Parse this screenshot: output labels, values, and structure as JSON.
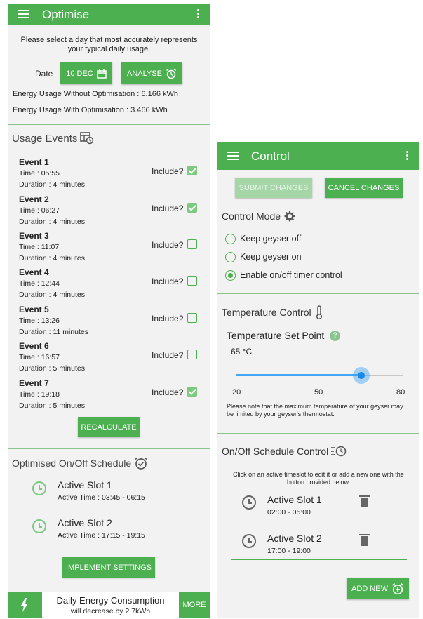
{
  "left": {
    "title": "Optimise",
    "intro": "Please select a day that most accurately represents your typical daily usage.",
    "date_label": "Date",
    "date_button": "10 DEC",
    "analyse_button": "ANALYSE",
    "usage_without": "Energy Usage Without Optimisation : 6.166 kWh",
    "usage_with": "Energy Usage With Optimisation : 3.466 kWh",
    "usage_events_heading": "Usage Events",
    "include_label": "Include?",
    "events": [
      {
        "name": "Event 1",
        "time": "Time : 05:55",
        "duration": "Duration : 4 minutes",
        "included": true
      },
      {
        "name": "Event 2",
        "time": "Time : 06:27",
        "duration": "Duration : 4 minutes",
        "included": true
      },
      {
        "name": "Event 3",
        "time": "Time : 11:07",
        "duration": "Duration : 4 minutes",
        "included": false
      },
      {
        "name": "Event 4",
        "time": "Time : 12:44",
        "duration": "Duration : 4 minutes",
        "included": false
      },
      {
        "name": "Event 5",
        "time": "Time : 13:26",
        "duration": "Duration : 11 minutes",
        "included": false
      },
      {
        "name": "Event 6",
        "time": "Time : 16:57",
        "duration": "Duration : 5 minutes",
        "included": false
      },
      {
        "name": "Event 7",
        "time": "Time : 19:18",
        "duration": "Duration : 5 minutes",
        "included": true
      }
    ],
    "recalculate_button": "RECALCULATE",
    "schedule_heading": "Optimised On/Off Schedule",
    "slots": [
      {
        "name": "Active Slot 1",
        "time": "Active Time : 03:45 - 06:15"
      },
      {
        "name": "Active Slot 2",
        "time": "Active Time : 17:15 - 19:15"
      }
    ],
    "implement_button": "IMPLEMENT SETTINGS",
    "footer_title": "Daily Energy Consumption",
    "footer_subtitle": "will decrease by 2.7kWh",
    "more_button": "MORE"
  },
  "right": {
    "title": "Control",
    "submit_button": "SUBMIT CHANGES",
    "cancel_button": "CANCEL CHANGES",
    "control_mode_heading": "Control Mode",
    "modes": [
      {
        "label": "Keep geyser off",
        "selected": false
      },
      {
        "label": "Keep geyser on",
        "selected": false
      },
      {
        "label": "Enable on/off timer control",
        "selected": true
      }
    ],
    "temperature_heading": "Temperature Control",
    "set_point_label": "Temperature Set Point",
    "set_point_value": "65 °C",
    "slider": {
      "min": 20,
      "max": 80,
      "value": 65,
      "min_label": "20",
      "mid_label": "50",
      "max_label": "80"
    },
    "thermostat_note": "Please note that the maximum temperature of your geyser may be limited by your geyser's thermostat.",
    "schedule_heading": "On/Off Schedule Control",
    "schedule_note": "Click on an active timeslot to edit it or add a new one with the button provided below.",
    "slots": [
      {
        "name": "Active Slot 1",
        "time": "02:00 - 05:00"
      },
      {
        "name": "Active Slot 2",
        "time": "17:00 - 19:00"
      }
    ],
    "add_new_button": "ADD NEW"
  },
  "colors": {
    "accent": "#4caf50",
    "accent_light": "#a5d6a7",
    "slider_thumb": "#42a5f5"
  }
}
